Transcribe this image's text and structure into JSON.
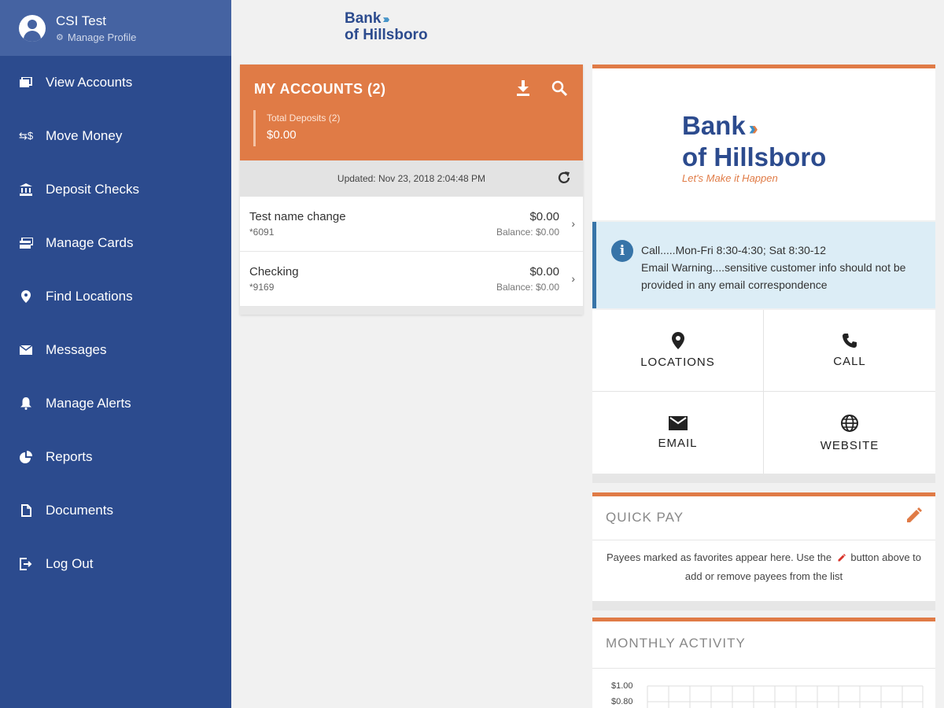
{
  "sidebar": {
    "profile": {
      "name": "CSI Test",
      "manage_label": "Manage Profile"
    },
    "items": [
      {
        "label": "View Accounts",
        "icon": "accounts-icon"
      },
      {
        "label": "Move Money",
        "icon": "move-money-icon"
      },
      {
        "label": "Deposit Checks",
        "icon": "bank-icon"
      },
      {
        "label": "Manage Cards",
        "icon": "cards-icon"
      },
      {
        "label": "Find Locations",
        "icon": "location-pin-icon"
      },
      {
        "label": "Messages",
        "icon": "envelope-icon"
      },
      {
        "label": "Manage Alerts",
        "icon": "bell-icon"
      },
      {
        "label": "Reports",
        "icon": "pie-chart-icon"
      },
      {
        "label": "Documents",
        "icon": "document-icon"
      },
      {
        "label": "Log Out",
        "icon": "logout-icon"
      }
    ]
  },
  "brand": {
    "line1": "Bank",
    "line2": "of Hillsboro",
    "tagline": "Let's Make it Happen"
  },
  "accounts": {
    "title": "MY ACCOUNTS (2)",
    "total_label": "Total Deposits (2)",
    "total_value": "$0.00",
    "updated": "Updated: Nov 23, 2018 2:04:48 PM",
    "rows": [
      {
        "name": "Test name change",
        "number": "*6091",
        "amount": "$0.00",
        "balance": "Balance: $0.00"
      },
      {
        "name": "Checking",
        "number": "*9169",
        "amount": "$0.00",
        "balance": "Balance: $0.00"
      }
    ]
  },
  "info": {
    "line1": "Call.....Mon-Fri 8:30-4:30; Sat 8:30-12",
    "line2": "Email Warning....sensitive customer info should not be provided in any email correspondence"
  },
  "contact": {
    "locations": "LOCATIONS",
    "call": "CALL",
    "email": "EMAIL",
    "website": "WEBSITE"
  },
  "quickpay": {
    "title": "QUICK PAY",
    "text_before": "Payees marked as favorites appear here. Use the",
    "text_after": "button above to add or remove payees from the list"
  },
  "monthly": {
    "title": "MONTHLY ACTIVITY",
    "ticks": [
      "$1.00",
      "$0.80"
    ]
  },
  "colors": {
    "sidebar": "#2c4b8e",
    "accent": "#e07b46",
    "info_bg": "#dcedf6",
    "info_border": "#3774a8"
  }
}
